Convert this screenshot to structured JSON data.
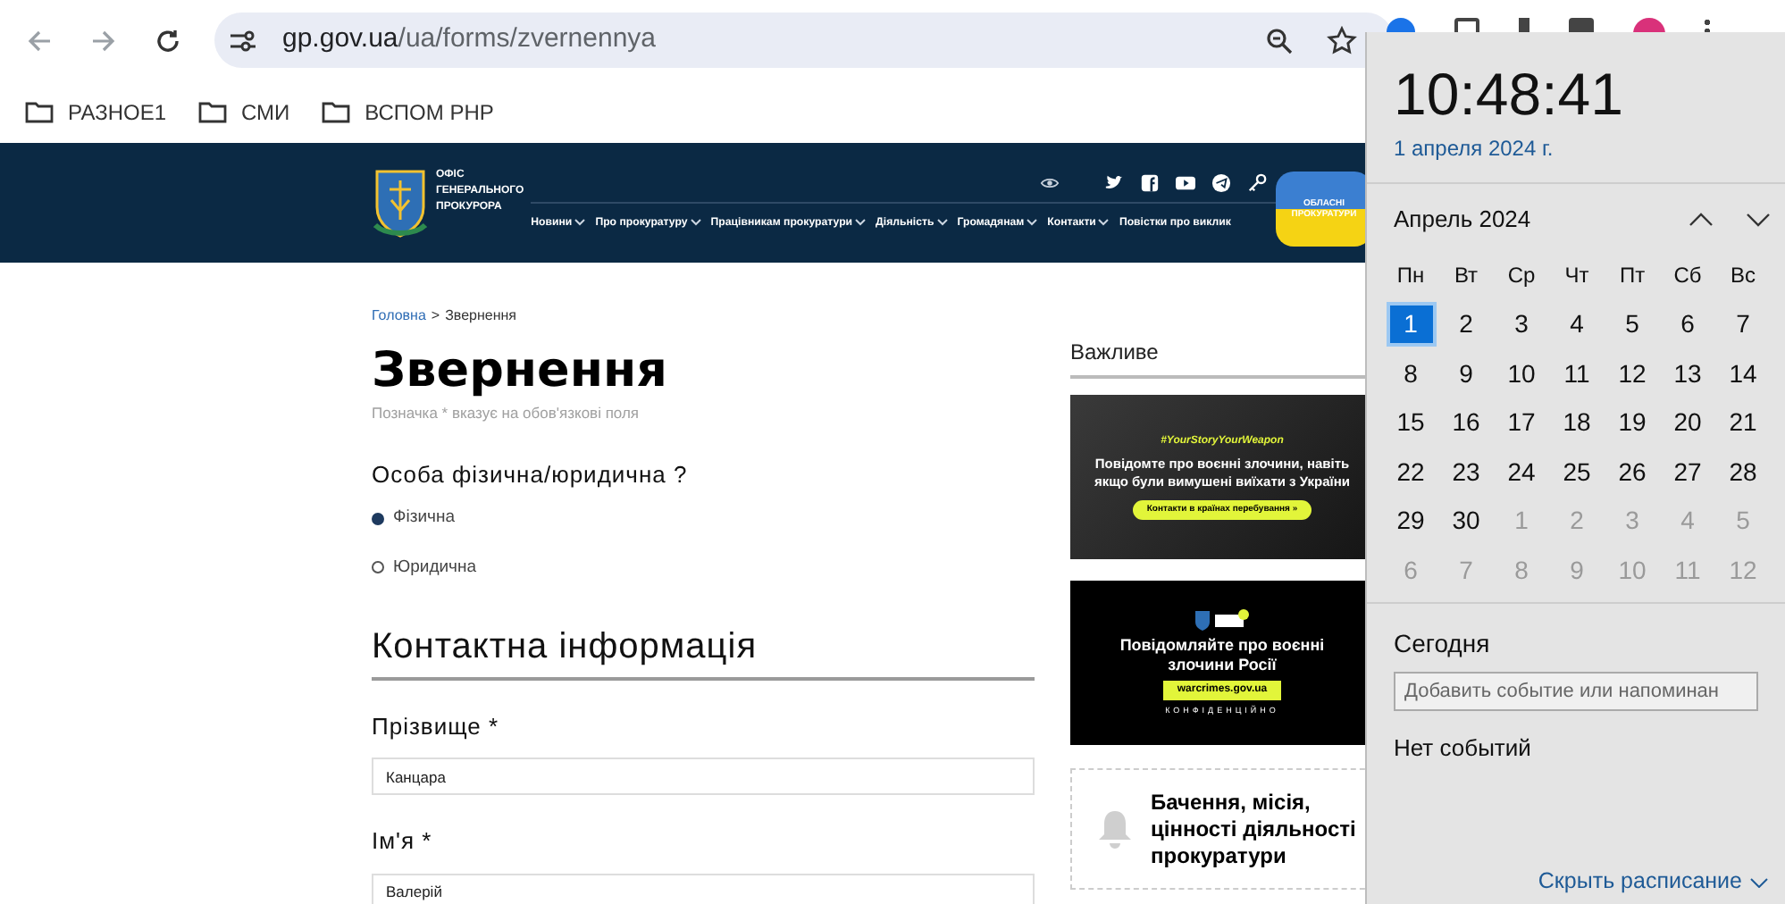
{
  "browser": {
    "address": {
      "domain": "gp.gov.ua",
      "path": "/ua/forms/zvernennya"
    },
    "bookmarks": [
      {
        "label": "РАЗНОЕ1"
      },
      {
        "label": "СМИ"
      },
      {
        "label": "ВСПОМ PHP"
      }
    ]
  },
  "site_header": {
    "logo_lines": [
      "ОФІС",
      "ГЕНЕРАЛЬНОГО",
      "ПРОКУРОРА"
    ],
    "nav": [
      {
        "label": "Новини",
        "dropdown": true
      },
      {
        "label": "Про прокуратуру",
        "dropdown": true
      },
      {
        "label": "Працівникам прокуратури",
        "dropdown": true
      },
      {
        "label": "Діяльність",
        "dropdown": true
      },
      {
        "label": "Громадянам",
        "dropdown": true
      },
      {
        "label": "Контакти",
        "dropdown": true
      },
      {
        "label": "Повістки про виклик",
        "dropdown": false
      }
    ],
    "regional_badge": "ОБЛАСНІ ПРОКУРАТУРИ"
  },
  "breadcrumb": [
    {
      "label": "Головна",
      "link": true
    },
    {
      "label": "Звернення",
      "link": false
    }
  ],
  "breadcrumb_separator": ">",
  "page_title": "Звернення",
  "required_hint": "Позначка * вказує на обов'язкові поля",
  "person_question": "Особа фізична/юридична ?",
  "person_options": [
    {
      "label": "Фізична",
      "selected": true
    },
    {
      "label": "Юридична",
      "selected": false
    }
  ],
  "section_title": "Контактна інформація",
  "fields": [
    {
      "label": "Прізвище *",
      "value": "Канцара"
    },
    {
      "label": "Ім'я *",
      "value": "Валерій"
    }
  ],
  "sidebar": {
    "title": "Важливе",
    "banners": [
      {
        "kind": "photo",
        "tag": "#YourStoryYourWeapon",
        "text": "Повідомте про воєнні злочини, навіть якщо були вимушені виїхати з України",
        "button": "Контакти в країнах перебування »"
      },
      {
        "kind": "dark",
        "text": "Повідомляйте про воєнні злочини Росії",
        "button": "warcrimes.gov.ua",
        "footer": "КОНФІДЕНЦІЙНО"
      }
    ],
    "card": "Бачення, місія, цінності діяльності прокуратури"
  },
  "calendar_flyout": {
    "time": "10:48:41",
    "date": "1 апреля 2024 г.",
    "month": "Апрель 2024",
    "weekdays": [
      "Пн",
      "Вт",
      "Ср",
      "Чт",
      "Пт",
      "Сб",
      "Вс"
    ],
    "days": [
      {
        "label": "1",
        "kind": "current",
        "selected": true
      },
      {
        "label": "2",
        "kind": "current",
        "selected": false
      },
      {
        "label": "3",
        "kind": "current",
        "selected": false
      },
      {
        "label": "4",
        "kind": "current",
        "selected": false
      },
      {
        "label": "5",
        "kind": "current",
        "selected": false
      },
      {
        "label": "6",
        "kind": "current",
        "selected": false
      },
      {
        "label": "7",
        "kind": "current",
        "selected": false
      },
      {
        "label": "8",
        "kind": "current",
        "selected": false
      },
      {
        "label": "9",
        "kind": "current",
        "selected": false
      },
      {
        "label": "10",
        "kind": "current",
        "selected": false
      },
      {
        "label": "11",
        "kind": "current",
        "selected": false
      },
      {
        "label": "12",
        "kind": "current",
        "selected": false
      },
      {
        "label": "13",
        "kind": "current",
        "selected": false
      },
      {
        "label": "14",
        "kind": "current",
        "selected": false
      },
      {
        "label": "15",
        "kind": "current",
        "selected": false
      },
      {
        "label": "16",
        "kind": "current",
        "selected": false
      },
      {
        "label": "17",
        "kind": "current",
        "selected": false
      },
      {
        "label": "18",
        "kind": "current",
        "selected": false
      },
      {
        "label": "19",
        "kind": "current",
        "selected": false
      },
      {
        "label": "20",
        "kind": "current",
        "selected": false
      },
      {
        "label": "21",
        "kind": "current",
        "selected": false
      },
      {
        "label": "22",
        "kind": "current",
        "selected": false
      },
      {
        "label": "23",
        "kind": "current",
        "selected": false
      },
      {
        "label": "24",
        "kind": "current",
        "selected": false
      },
      {
        "label": "25",
        "kind": "current",
        "selected": false
      },
      {
        "label": "26",
        "kind": "current",
        "selected": false
      },
      {
        "label": "27",
        "kind": "current",
        "selected": false
      },
      {
        "label": "28",
        "kind": "current",
        "selected": false
      },
      {
        "label": "29",
        "kind": "current",
        "selected": false
      },
      {
        "label": "30",
        "kind": "current",
        "selected": false
      },
      {
        "label": "1",
        "kind": "other",
        "selected": false
      },
      {
        "label": "2",
        "kind": "other",
        "selected": false
      },
      {
        "label": "3",
        "kind": "other",
        "selected": false
      },
      {
        "label": "4",
        "kind": "other",
        "selected": false
      },
      {
        "label": "5",
        "kind": "other",
        "selected": false
      },
      {
        "label": "6",
        "kind": "other",
        "selected": false
      },
      {
        "label": "7",
        "kind": "other",
        "selected": false
      },
      {
        "label": "8",
        "kind": "other",
        "selected": false
      },
      {
        "label": "9",
        "kind": "other",
        "selected": false
      },
      {
        "label": "10",
        "kind": "other",
        "selected": false
      },
      {
        "label": "11",
        "kind": "other",
        "selected": false
      },
      {
        "label": "12",
        "kind": "other",
        "selected": false
      }
    ],
    "today_title": "Сегодня",
    "event_placeholder": "Добавить событие или напоминан",
    "no_events": "Нет событий",
    "hide_link": "Скрыть расписание"
  }
}
